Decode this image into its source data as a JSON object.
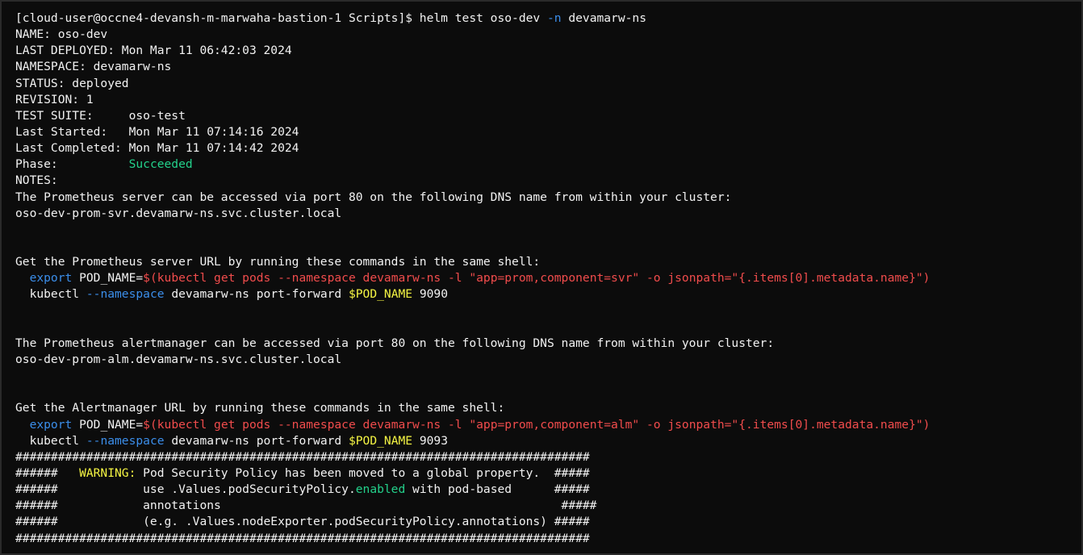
{
  "window": {
    "type": "terminal",
    "background": "#0c0c0c",
    "foreground": "#f2f2f2"
  },
  "colors": {
    "default": "#f2f2f2",
    "blue": "#3b8eea",
    "red": "#f14c4c",
    "green": "#23d18b",
    "yellow": "#f5f543"
  },
  "lines": [
    [
      {
        "t": "[cloud-user@occne4-devansh-m-marwaha-bastion-1 Scripts]$ helm test oso-dev ",
        "c": "default"
      },
      {
        "t": "-n",
        "c": "blue"
      },
      {
        "t": " devamarw-ns",
        "c": "default"
      }
    ],
    [
      {
        "t": "NAME: oso-dev",
        "c": "default"
      }
    ],
    [
      {
        "t": "LAST DEPLOYED: Mon Mar 11 06:42:03 2024",
        "c": "default"
      }
    ],
    [
      {
        "t": "NAMESPACE: devamarw-ns",
        "c": "default"
      }
    ],
    [
      {
        "t": "STATUS: deployed",
        "c": "default"
      }
    ],
    [
      {
        "t": "REVISION: 1",
        "c": "default"
      }
    ],
    [
      {
        "t": "TEST SUITE:     oso-test",
        "c": "default"
      }
    ],
    [
      {
        "t": "Last Started:   Mon Mar 11 07:14:16 2024",
        "c": "default"
      }
    ],
    [
      {
        "t": "Last Completed: Mon Mar 11 07:14:42 2024",
        "c": "default"
      }
    ],
    [
      {
        "t": "Phase:          ",
        "c": "default"
      },
      {
        "t": "Succeeded",
        "c": "green"
      }
    ],
    [
      {
        "t": "NOTES:",
        "c": "default"
      }
    ],
    [
      {
        "t": "The Prometheus server can be accessed via port 80 on the following DNS name from within your cluster:",
        "c": "default"
      }
    ],
    [
      {
        "t": "oso-dev-prom-svr.devamarw-ns.svc.cluster.local",
        "c": "default"
      }
    ],
    [
      {
        "t": "",
        "c": "default"
      }
    ],
    [
      {
        "t": "",
        "c": "default"
      }
    ],
    [
      {
        "t": "Get the Prometheus server URL by running these commands in the same shell:",
        "c": "default"
      }
    ],
    [
      {
        "t": "  ",
        "c": "default"
      },
      {
        "t": "export",
        "c": "blue"
      },
      {
        "t": " POD_NAME=",
        "c": "default"
      },
      {
        "t": "$(kubectl get pods --namespace devamarw-ns -l \"app=prom,component=svr\" -o jsonpath=\"{.items[0].metadata.name}\")",
        "c": "red"
      }
    ],
    [
      {
        "t": "  kubectl ",
        "c": "default"
      },
      {
        "t": "--namespace",
        "c": "blue"
      },
      {
        "t": " devamarw-ns port-forward ",
        "c": "default"
      },
      {
        "t": "$POD_NAME",
        "c": "yellow"
      },
      {
        "t": " 9090",
        "c": "default"
      }
    ],
    [
      {
        "t": "",
        "c": "default"
      }
    ],
    [
      {
        "t": "",
        "c": "default"
      }
    ],
    [
      {
        "t": "The Prometheus alertmanager can be accessed via port 80 on the following DNS name from within your cluster:",
        "c": "default"
      }
    ],
    [
      {
        "t": "oso-dev-prom-alm.devamarw-ns.svc.cluster.local",
        "c": "default"
      }
    ],
    [
      {
        "t": "",
        "c": "default"
      }
    ],
    [
      {
        "t": "",
        "c": "default"
      }
    ],
    [
      {
        "t": "Get the Alertmanager URL by running these commands in the same shell:",
        "c": "default"
      }
    ],
    [
      {
        "t": "  ",
        "c": "default"
      },
      {
        "t": "export",
        "c": "blue"
      },
      {
        "t": " POD_NAME=",
        "c": "default"
      },
      {
        "t": "$(kubectl get pods --namespace devamarw-ns -l \"app=prom,component=alm\" -o jsonpath=\"{.items[0].metadata.name}\")",
        "c": "red"
      }
    ],
    [
      {
        "t": "  kubectl ",
        "c": "default"
      },
      {
        "t": "--namespace",
        "c": "blue"
      },
      {
        "t": " devamarw-ns port-forward ",
        "c": "default"
      },
      {
        "t": "$POD_NAME",
        "c": "yellow"
      },
      {
        "t": " 9093",
        "c": "default"
      }
    ],
    [
      {
        "t": "#################################################################################",
        "c": "default"
      }
    ],
    [
      {
        "t": "######   ",
        "c": "default"
      },
      {
        "t": "WARNING:",
        "c": "yellow"
      },
      {
        "t": " Pod Security Policy has been moved to a global property.  #####",
        "c": "default"
      }
    ],
    [
      {
        "t": "######            use .Values.podSecurityPolicy.",
        "c": "default"
      },
      {
        "t": "enabled",
        "c": "green"
      },
      {
        "t": " with pod-based      #####",
        "c": "default"
      }
    ],
    [
      {
        "t": "######            annotations                                                #####",
        "c": "default"
      }
    ],
    [
      {
        "t": "######            (e.g. .Values.nodeExporter.podSecurityPolicy.annotations) #####",
        "c": "default"
      }
    ],
    [
      {
        "t": "#################################################################################",
        "c": "default"
      }
    ]
  ]
}
